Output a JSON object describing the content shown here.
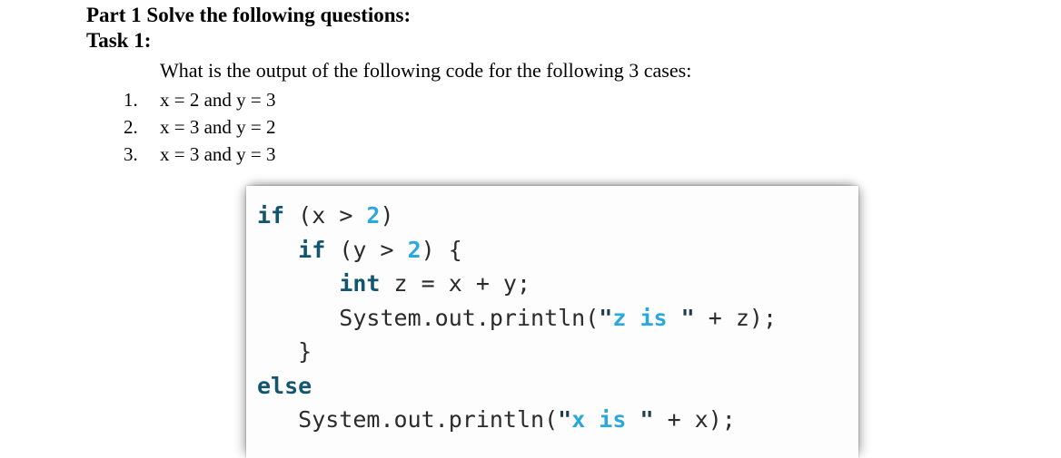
{
  "document": {
    "part_heading": "Part 1 Solve the following questions:",
    "task_heading": "Task 1:",
    "prompt": "What is the output of the following code for the following 3 cases:",
    "cases": [
      {
        "number": "1.",
        "text": "x = 2 and y = 3"
      },
      {
        "number": "2.",
        "text": "x = 3 and y = 2"
      },
      {
        "number": "3.",
        "text": "x = 3 and y = 3"
      }
    ]
  },
  "code_panel": {
    "language": "java",
    "background": "#fdfdfd",
    "colors": {
      "keyword": "#115570",
      "number": "#29a8de",
      "string": "#29a8de",
      "quote": "#1d3c52",
      "plain": "#2b2b2b"
    },
    "lines": [
      {
        "id": "line-1",
        "text": "if (x > 2)",
        "tokens": [
          {
            "t": "if",
            "k": "kw"
          },
          {
            "t": " (x > ",
            "k": "pln"
          },
          {
            "t": "2",
            "k": "num"
          },
          {
            "t": ")",
            "k": "pln"
          }
        ]
      },
      {
        "id": "line-2",
        "text": "   if (y > 2) {",
        "tokens": [
          {
            "t": "   ",
            "k": "pln"
          },
          {
            "t": "if",
            "k": "kw"
          },
          {
            "t": " (y > ",
            "k": "pln"
          },
          {
            "t": "2",
            "k": "num"
          },
          {
            "t": ") {",
            "k": "pln"
          }
        ]
      },
      {
        "id": "line-3",
        "text": "      int z = x + y;",
        "tokens": [
          {
            "t": "      ",
            "k": "pln"
          },
          {
            "t": "int",
            "k": "kw"
          },
          {
            "t": " z = x + y;",
            "k": "pln"
          }
        ]
      },
      {
        "id": "line-4",
        "text": "      System.out.println(\"z is \" + z);",
        "tokens": [
          {
            "t": "      System.out.println(",
            "k": "pln"
          },
          {
            "t": "\"",
            "k": "quo"
          },
          {
            "t": "z is ",
            "k": "str"
          },
          {
            "t": "\"",
            "k": "quo"
          },
          {
            "t": " + z);",
            "k": "pln"
          }
        ]
      },
      {
        "id": "line-5",
        "text": "   }",
        "tokens": [
          {
            "t": "   }",
            "k": "pln"
          }
        ]
      },
      {
        "id": "line-6",
        "text": "else",
        "tokens": [
          {
            "t": "else",
            "k": "kw"
          }
        ]
      },
      {
        "id": "line-7",
        "text": "   System.out.println(\"x is \" + x);",
        "tokens": [
          {
            "t": "   System.out.println(",
            "k": "pln"
          },
          {
            "t": "\"",
            "k": "quo"
          },
          {
            "t": "x is ",
            "k": "str"
          },
          {
            "t": "\"",
            "k": "quo"
          },
          {
            "t": " + x);",
            "k": "pln"
          }
        ]
      }
    ]
  }
}
